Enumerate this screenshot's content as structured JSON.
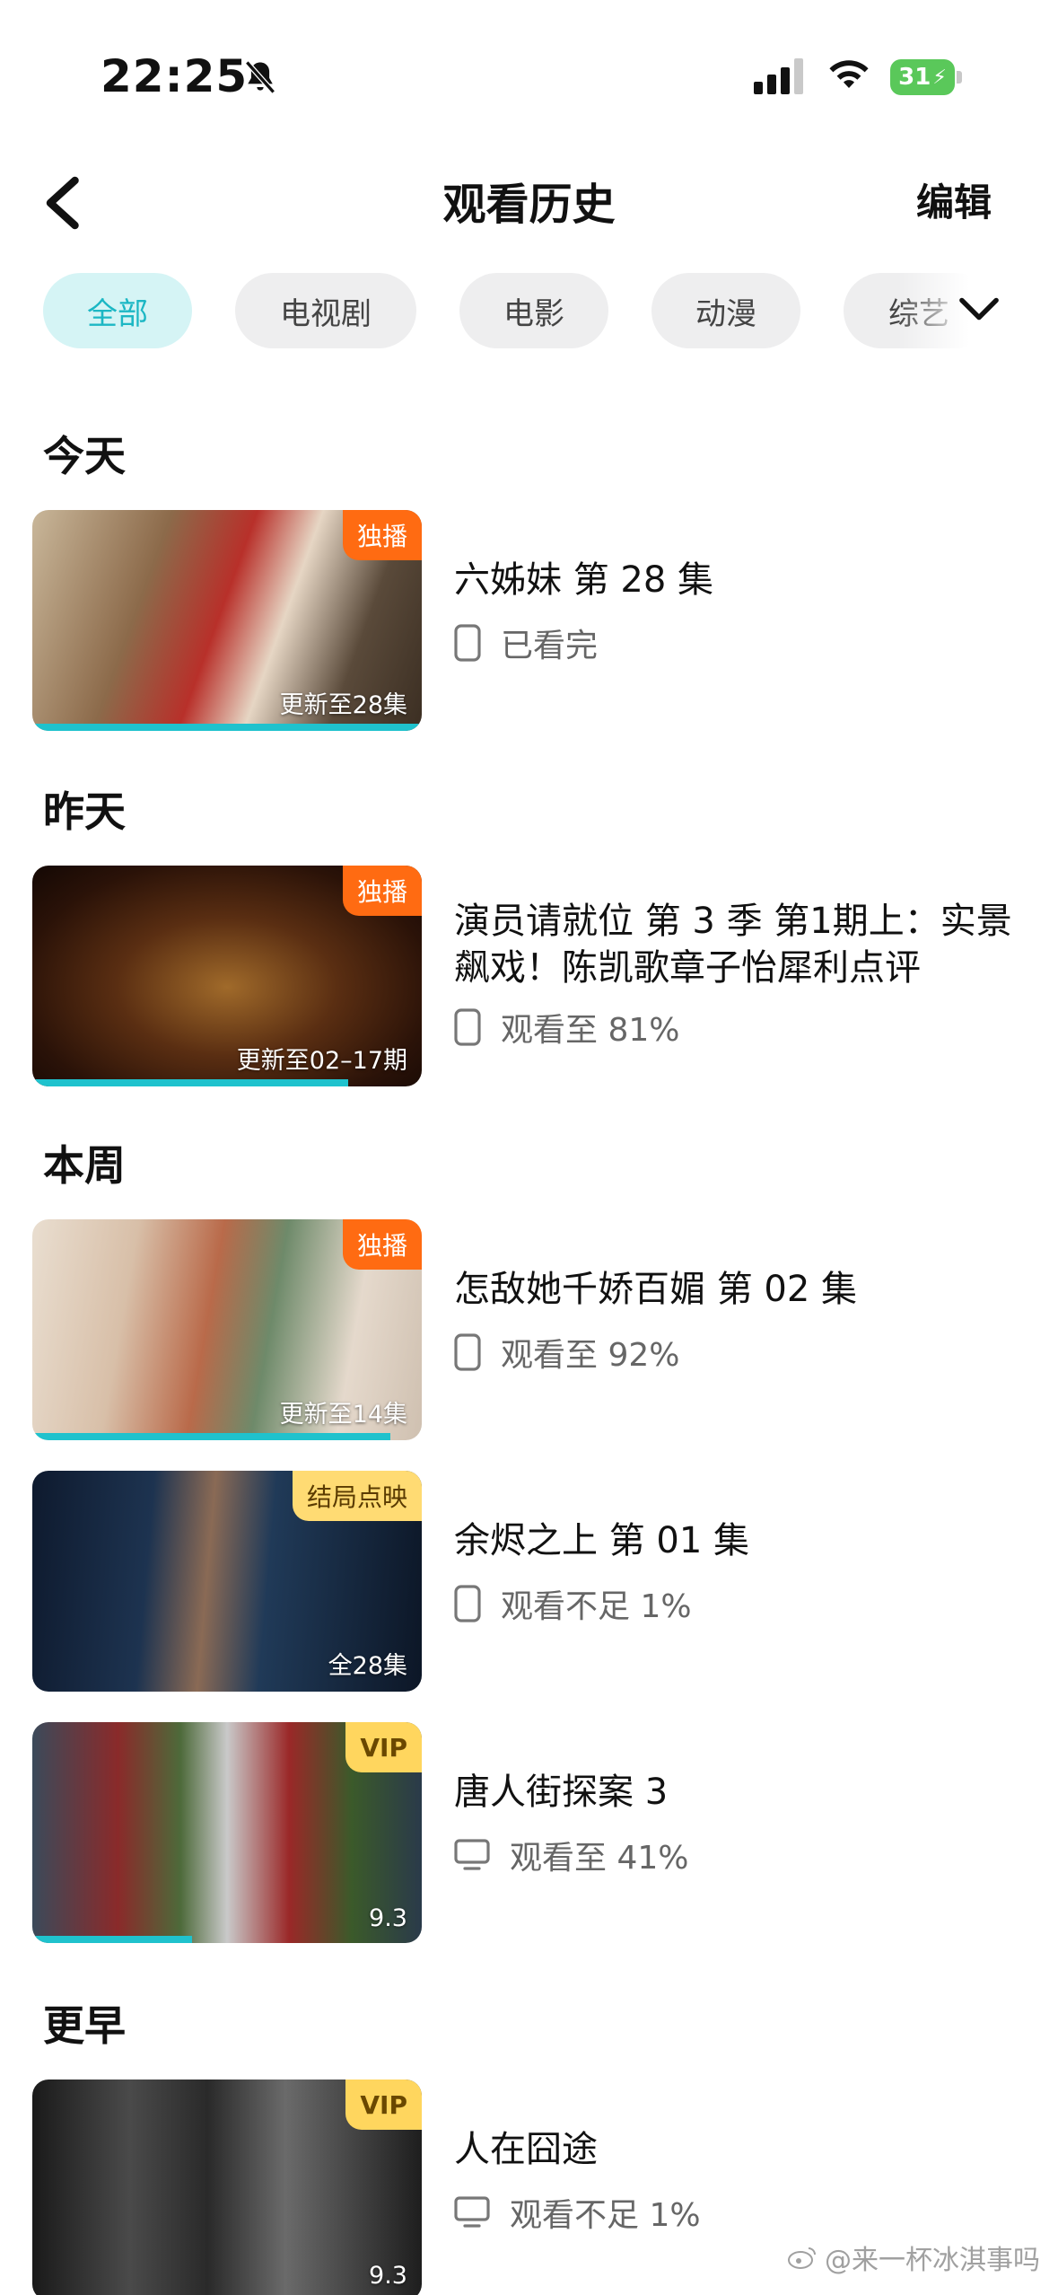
{
  "status_bar": {
    "time": "22:25",
    "battery": "31"
  },
  "nav": {
    "title": "观看历史",
    "edit": "编辑"
  },
  "filters": [
    {
      "label": "全部",
      "active": true
    },
    {
      "label": "电视剧",
      "active": false
    },
    {
      "label": "电影",
      "active": false
    },
    {
      "label": "动漫",
      "active": false
    },
    {
      "label": "综艺",
      "active": false
    }
  ],
  "sections": {
    "today": "今天",
    "yesterday": "昨天",
    "this_week": "本周",
    "earlier": "更早"
  },
  "items": [
    {
      "title": "六姊妹 第 28 集",
      "badge": "独播",
      "caption": "更新至28集",
      "status": "已看完",
      "device": "phone-icon",
      "progress": 1.0
    },
    {
      "title": "演员请就位 第 3 季 第1期上：实景飙戏！陈凯歌章子怡犀利点评",
      "badge": "独播",
      "caption": "更新至02–17期",
      "status": "观看至 81%",
      "device": "phone-icon",
      "progress": 0.81
    },
    {
      "title": "怎敌她千娇百媚 第 02 集",
      "badge": "独播",
      "caption": "更新至14集",
      "status": "观看至 92%",
      "device": "phone-icon",
      "progress": 0.92
    },
    {
      "title": "余烬之上 第 01 集",
      "badge": "结局点映",
      "caption": "全28集",
      "status": "观看不足 1%",
      "device": "phone-icon",
      "progress": 0.0
    },
    {
      "title": "唐人街探案 3",
      "badge": "VIP",
      "caption": "9.3",
      "status": "观看至 41%",
      "device": "tv-icon",
      "progress": 0.41
    },
    {
      "title": "人在囧途",
      "badge": "VIP",
      "caption": "9.3",
      "status": "观看不足 1%",
      "device": "tv-icon",
      "progress": 0.0
    }
  ],
  "watermark": "@来一杯冰淇事吗",
  "colors": {
    "accent": "#1fc2cd",
    "exclusive": "#ff6b12",
    "vip": "#ffd65e"
  }
}
